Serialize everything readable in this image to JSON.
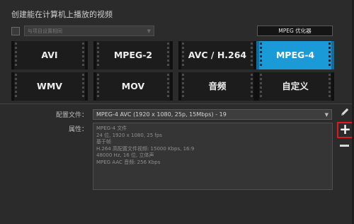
{
  "header": {
    "title": "创建能在计算机上播放的视频"
  },
  "project_match": {
    "checkbox_checked": false,
    "select_value": "与项目设置相同"
  },
  "optimizer_button": "MPEG 优化器",
  "formats": [
    {
      "label": "AVI",
      "active": false
    },
    {
      "label": "MPEG-2",
      "active": false
    },
    {
      "label": "AVC / H.264",
      "active": false
    },
    {
      "label": "MPEG-4",
      "active": true
    },
    {
      "label": "WMV",
      "active": false
    },
    {
      "label": "MOV",
      "active": false
    },
    {
      "label": "音频",
      "active": false
    },
    {
      "label": "自定义",
      "active": false
    }
  ],
  "profile": {
    "label": "配置文件：",
    "value": "MPEG-4 AVC (1920 x 1080, 25p, 15Mbps) - 19"
  },
  "properties": {
    "label": "属性：",
    "lines": [
      "MPEG-4 文件",
      "24 位, 1920 x 1080, 25 fps",
      "基于帧",
      "H.264 高配置文件视频: 15000 Kbps, 16:9",
      "48000 Hz, 16 位, 立体声",
      "MPEG AAC 音频: 256 Kbps"
    ]
  },
  "side_icons": {
    "edit": "pencil-icon",
    "add": "plus-icon",
    "remove": "minus-icon"
  },
  "colors": {
    "active_tile": "#1a9ad6",
    "highlight_border": "#e0191f",
    "background": "#2b2b2b"
  }
}
